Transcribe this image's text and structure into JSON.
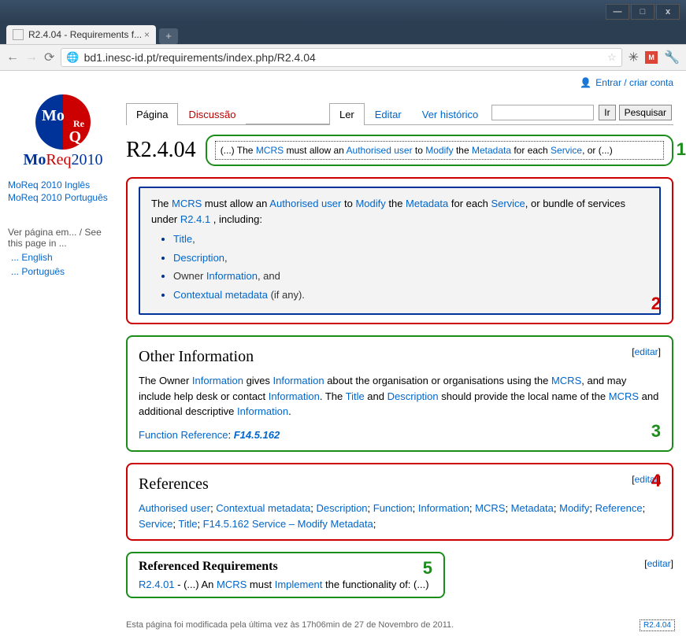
{
  "window": {
    "tab_title": "R2.4.04 - Requirements f...",
    "minimize": "—",
    "maximize": "□",
    "close": "x",
    "new_tab": "+"
  },
  "nav": {
    "back": "←",
    "forward": "→",
    "reload": "⟳",
    "url": "bd1.inesc-id.pt/requirements/index.php/R2.4.04",
    "star": "☆",
    "gmail": "M"
  },
  "login": "Entrar / criar conta",
  "logo": {
    "mo": "Mo",
    "re": "Re",
    "q": "Q",
    "text_mo": "Mo",
    "text_req": "Req",
    "text_year": "2010"
  },
  "sidebar": {
    "links": [
      "MoReq 2010 Inglês",
      "MoReq 2010 Português"
    ],
    "section_label": "Ver página em... / See this page in ...",
    "langs": [
      "... English",
      "... Português"
    ]
  },
  "tabs": {
    "pagina": "Página",
    "discussao": "Discussão",
    "ler": "Ler",
    "editar": "Editar",
    "historico": "Ver histórico",
    "ir": "Ir",
    "pesquisar": "Pesquisar"
  },
  "title": "R2.4.04",
  "summary": {
    "num": "1",
    "pre": "(...) The ",
    "mcrs": "MCRS",
    "t1": " must allow an ",
    "auth": "Authorised user",
    "t2": " to ",
    "modify": "Modify",
    "t3": " the ",
    "meta": "Metadata",
    "t4": " for each ",
    "service": "Service",
    "t5": ", or (...)"
  },
  "box2": {
    "num": "2",
    "pre": "The ",
    "mcrs": "MCRS",
    "t1": " must allow an ",
    "auth": "Authorised user",
    "t2": " to ",
    "modify": "Modify",
    "t3": " the ",
    "meta": "Metadata",
    "t4": " for each ",
    "service": "Service",
    "t5": ", or bundle of services under ",
    "ref": "R2.4.1",
    "t6": " , including:",
    "items": {
      "title": "Title",
      "desc": "Description",
      "owner_pre": "Owner ",
      "info": "Information",
      "owner_post": ", and",
      "ctx": "Contextual metadata",
      "ctx_post": " (if any)."
    }
  },
  "box3": {
    "heading": "Other Information",
    "edit": "editar",
    "num": "3",
    "p1a": "The Owner ",
    "info1": "Information",
    "p1b": " gives ",
    "info2": "Information",
    "p1c": " about the organisation or organisations using the ",
    "mcrs": "MCRS",
    "p1d": ", and may include help desk or contact ",
    "info3": "Information",
    "p1e": ". The ",
    "title": "Title",
    "p1f": " and ",
    "desc": "Description",
    "p1g": " should provide the local name of the ",
    "mcrs2": "MCRS",
    "p1h": " and additional descriptive ",
    "info4": "Information",
    "p1i": ".",
    "fn_pre": "Function Reference",
    "fn_sep": ": ",
    "fn_ref": "F14.5.162"
  },
  "box4": {
    "heading": "References",
    "edit": "editar",
    "num": "4",
    "refs": [
      "Authorised user",
      "Contextual metadata",
      "Description",
      "Function",
      "Information",
      "MCRS",
      "Metadata",
      "Modify",
      "Reference",
      "Service",
      "Title",
      "F14.5.162 Service – Modify Metadata"
    ],
    "sep": "; "
  },
  "box5": {
    "heading": "Referenced Requirements",
    "edit": "editar",
    "num": "5",
    "ref": "R2.4.01",
    "t1": " - (...) An ",
    "mcrs": "MCRS",
    "t2": " must ",
    "impl": "Implement",
    "t3": " the functionality of: (...)"
  },
  "footer": "Esta página foi modificada pela última vez às 17h06min de 27 de Novembro de 2011.",
  "footer_badge": "R2.4.04"
}
